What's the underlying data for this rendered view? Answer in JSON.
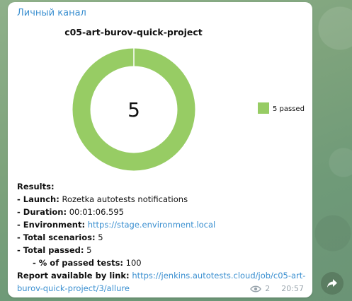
{
  "channel": {
    "name": "Личный канал"
  },
  "chart_data": {
    "type": "pie",
    "title": "c05-art-burov-quick-project",
    "center_label": "5",
    "categories": [
      "passed"
    ],
    "values": [
      5
    ],
    "legend": [
      {
        "label": "5 passed",
        "color": "#97cc64"
      }
    ],
    "legend_position": "right",
    "colors": {
      "passed": "#97cc64"
    }
  },
  "results": {
    "heading": "Results:",
    "launch_label": " - Launch:",
    "launch_value": " Rozetka autotests notifications",
    "duration_label": " - Duration:",
    "duration_value": " 00:01:06.595",
    "environment_label": " - Environment:",
    "environment_link": "https://stage.environment.local",
    "total_scenarios_label": " - Total scenarios:",
    "total_scenarios_value": " 5",
    "total_passed_label": " - Total passed:",
    "total_passed_value": " 5",
    "percent_label": "- % of passed tests:",
    "percent_value": " 100",
    "report_label": " Report available by link:",
    "report_link": "https://jenkins.autotests.cloud/job/c05-art-burov-quick-project/3/allure"
  },
  "meta": {
    "views": "2",
    "time": "20:57",
    "views_icon": "eye-icon"
  },
  "share": {
    "icon": "share-arrow-icon"
  }
}
